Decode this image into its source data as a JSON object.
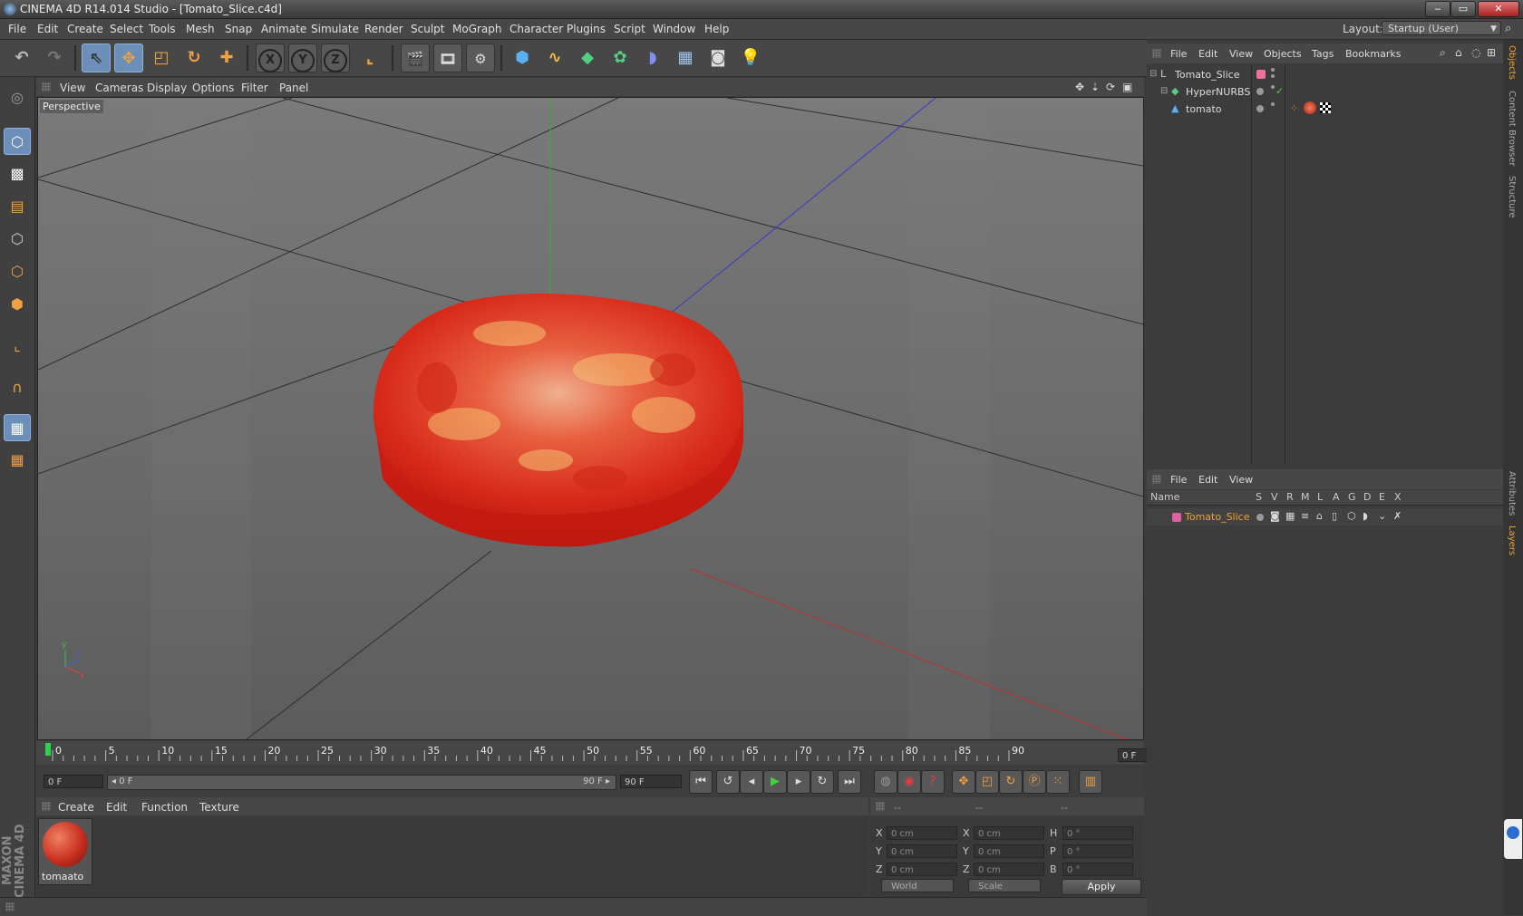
{
  "window": {
    "title": "CINEMA 4D R14.014 Studio - [Tomato_Slice.c4d]",
    "buttons": {
      "minimize": "‒",
      "maximize": "▭",
      "close": "✕"
    }
  },
  "menubar": {
    "items": [
      "File",
      "Edit",
      "Create",
      "Select",
      "Tools",
      "Mesh",
      "Snap",
      "Animate",
      "Simulate",
      "Render",
      "Sculpt",
      "MoGraph",
      "Character",
      "Plugins",
      "Script",
      "Window",
      "Help"
    ],
    "layout_label": "Layout:",
    "layout_value": "Startup (User)"
  },
  "toolbar": {
    "icons": [
      "undo-icon",
      "redo-icon",
      "live-select-icon",
      "move-icon",
      "scale-icon",
      "rotate-icon",
      "add-icon",
      "x-axis-icon",
      "y-axis-icon",
      "z-axis-icon",
      "world-coords-icon",
      "render-view-icon",
      "render-picture-viewer-icon",
      "render-settings-icon",
      "cube-primitive-icon",
      "spline-icon",
      "nurbs-icon",
      "array-icon",
      "deformer-icon",
      "floor-icon",
      "camera-icon",
      "light-icon"
    ],
    "axis_labels": {
      "x": "X",
      "y": "Y",
      "z": "Z"
    }
  },
  "viewport": {
    "menu": [
      "View",
      "Cameras",
      "Display",
      "Options",
      "Filter",
      "Panel"
    ],
    "label": "Perspective",
    "axis_gizmo": {
      "y": "y",
      "z": "z",
      "x": "x"
    }
  },
  "timeline": {
    "ticks": [
      "0",
      "5",
      "10",
      "15",
      "20",
      "25",
      "30",
      "35",
      "40",
      "45",
      "50",
      "55",
      "60",
      "65",
      "70",
      "75",
      "80",
      "85",
      "90"
    ],
    "current_frame": "0 F"
  },
  "transport": {
    "start_field": "0 F",
    "range_start": "◂ 0 F",
    "range_end": "90 F ▸",
    "end_field": "90 F"
  },
  "material_manager": {
    "menu": [
      "Create",
      "Edit",
      "Function",
      "Texture"
    ],
    "materials": [
      {
        "name": "tomaato"
      }
    ]
  },
  "coordinates": {
    "headers": [
      "--",
      "--",
      "--"
    ],
    "rows": [
      {
        "a": "X",
        "av": "0 cm",
        "b": "X",
        "bv": "0 cm",
        "c": "H",
        "cv": "0 °"
      },
      {
        "a": "Y",
        "av": "0 cm",
        "b": "Y",
        "bv": "0 cm",
        "c": "P",
        "cv": "0 °"
      },
      {
        "a": "Z",
        "av": "0 cm",
        "b": "Z",
        "bv": "0 cm",
        "c": "B",
        "cv": "0 °"
      }
    ],
    "mode": "World",
    "transform": "Scale",
    "apply_label": "Apply"
  },
  "object_manager": {
    "menu": [
      "File",
      "Edit",
      "View",
      "Objects",
      "Tags",
      "Bookmarks"
    ],
    "objects": [
      {
        "name": "Tomato_Slice"
      },
      {
        "name": "HyperNURBS"
      },
      {
        "name": "tomato"
      }
    ]
  },
  "layer_manager": {
    "menu": [
      "File",
      "Edit",
      "View"
    ],
    "columns": [
      "Name",
      "S",
      "V",
      "R",
      "M",
      "L",
      "A",
      "G",
      "D",
      "E",
      "X"
    ],
    "layers": [
      {
        "name": "Tomato_Slice",
        "color": "#e060a0"
      }
    ]
  },
  "side_tabs": [
    "Objects",
    "Content Browser",
    "Structure",
    "Attributes",
    "Layers"
  ],
  "brand": "MAXON CINEMA 4D",
  "colors": {
    "accent": "#6b8fb8",
    "layer_highlight": "#f0a030",
    "tomato": "#d8281c"
  }
}
